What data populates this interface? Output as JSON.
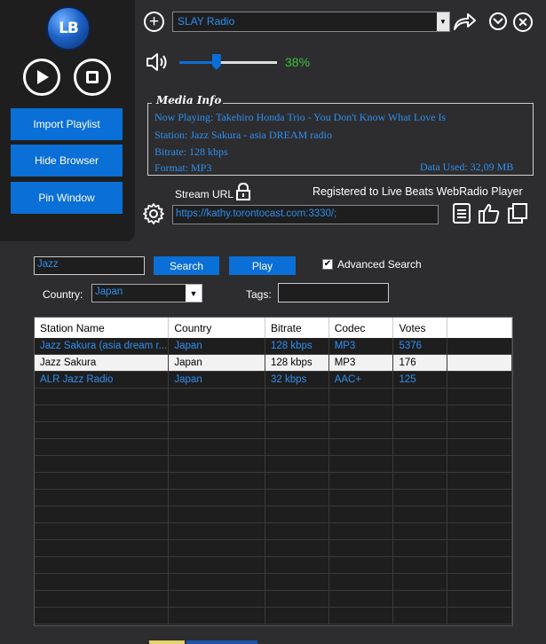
{
  "app": {
    "logo_text": "LB"
  },
  "sidebar": {
    "import_label": "Import Playlist",
    "hide_browser_label": "Hide Browser",
    "pin_label": "Pin Window"
  },
  "player": {
    "station_selected": "SLAY Radio",
    "volume_percent": 38,
    "volume_text": "38%"
  },
  "media_info": {
    "title": "Media Info",
    "now_playing": "Now Playing: Takehiro Honda Trio - You Don't Know What Love Is",
    "station": "Station: Jazz Sakura - asia DREAM radio",
    "bitrate": "Bitrate: 128 kbps",
    "format": "Format: MP3",
    "data_used": "Data Used: 32,09 MB"
  },
  "stream": {
    "label": "Stream URL",
    "url": "https://kathy.torontocast.com:3330/;",
    "registered": "Registered to Live Beats WebRadio Player"
  },
  "search": {
    "query": "Jazz",
    "search_label": "Search",
    "play_label": "Play",
    "advanced_label": "Advanced Search",
    "advanced_checked": true,
    "country_label": "Country:",
    "country_value": "Japan",
    "tags_label": "Tags:",
    "tags_value": ""
  },
  "table": {
    "columns": [
      "Station Name",
      "Country",
      "Bitrate",
      "Codec",
      "Votes"
    ],
    "rows": [
      [
        "Jazz Sakura (asia dream r...",
        "Japan",
        "128 kbps",
        "MP3",
        "5376"
      ],
      [
        "Jazz Sakura",
        "Japan",
        "128 kbps",
        "MP3",
        "176"
      ],
      [
        "ALR Jazz Radio",
        "Japan",
        "32 kbps",
        "AAC+",
        "125"
      ]
    ],
    "selected_row": 1
  },
  "colors": {
    "accent": "#0a6fd6",
    "link_text": "#2e8fef",
    "volume_green": "#3ac43a"
  },
  "icons": [
    "play-icon",
    "stop-icon",
    "plus-icon",
    "share-icon",
    "chevron-down-icon",
    "close-icon",
    "speaker-icon",
    "lock-icon",
    "gear-icon",
    "book-icon",
    "thumbs-up-icon",
    "copy-icon"
  ]
}
